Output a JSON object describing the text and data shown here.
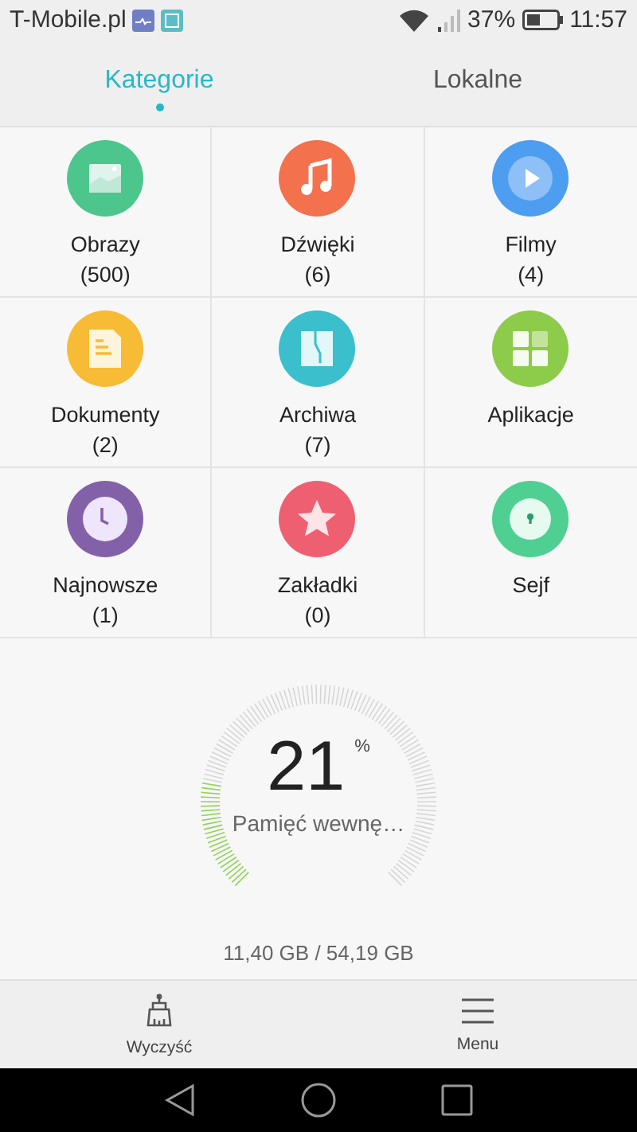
{
  "status_bar": {
    "carrier": "T-Mobile.pl",
    "battery_percent": "37%",
    "time": "11:57"
  },
  "tabs": [
    {
      "label": "Kategorie",
      "selected": true
    },
    {
      "label": "Lokalne",
      "selected": false
    }
  ],
  "categories": [
    {
      "kind": "images",
      "label": "Obrazy",
      "count": "(500)",
      "color": "#4cc68c"
    },
    {
      "kind": "music",
      "label": "Dźwięki",
      "count": "(6)",
      "color": "#f4714e"
    },
    {
      "kind": "video",
      "label": "Filmy",
      "count": "(4)",
      "color": "#4d9df0"
    },
    {
      "kind": "document",
      "label": "Dokumenty",
      "count": "(2)",
      "color": "#f7bb36"
    },
    {
      "kind": "archive",
      "label": "Archiwa",
      "count": "(7)",
      "color": "#3bbfcc"
    },
    {
      "kind": "apps",
      "label": "Aplikacje",
      "color": "#8dcb4b"
    },
    {
      "kind": "recent",
      "label": "Najnowsze",
      "count": "(1)",
      "color": "#8361a8"
    },
    {
      "kind": "favorite",
      "label": "Zakładki",
      "count": "(0)",
      "color": "#ef5f72"
    },
    {
      "kind": "safe",
      "label": "Sejf",
      "color": "#4fcf92"
    }
  ],
  "storage": {
    "percent": "21",
    "unit": "%",
    "label": "Pamięć wewnę…",
    "usage": "11,40 GB / 54,19 GB"
  },
  "bottom_bar": [
    {
      "kind": "clean",
      "label": "Wyczyść"
    },
    {
      "kind": "menu",
      "label": "Menu"
    }
  ]
}
